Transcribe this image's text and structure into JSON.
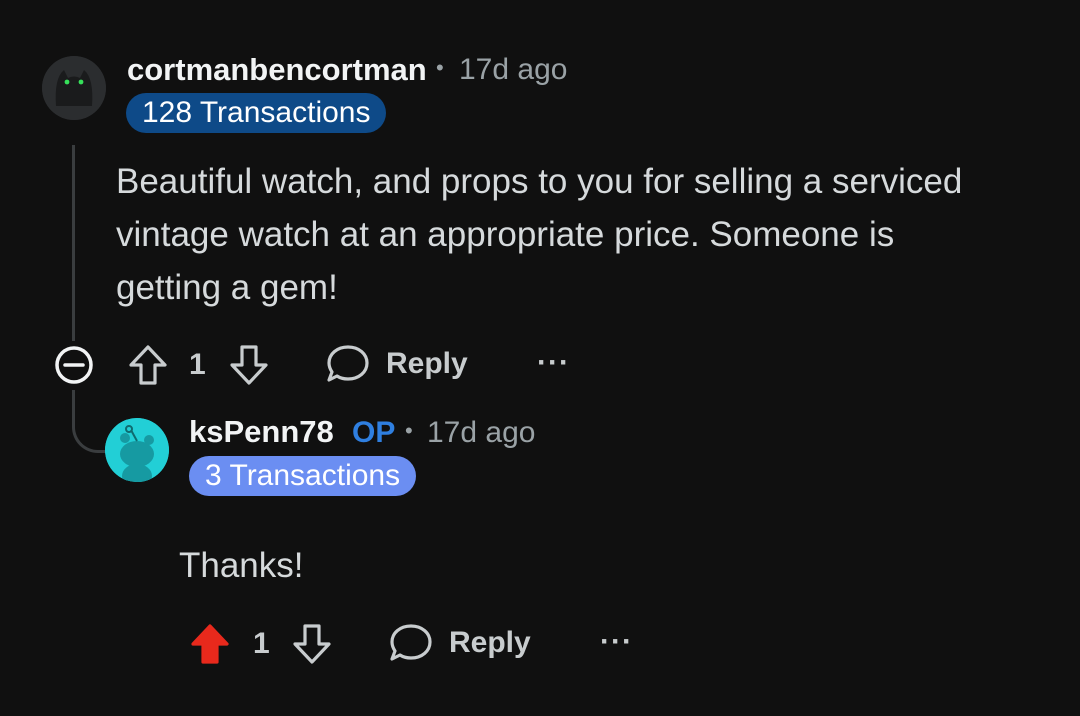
{
  "comments": [
    {
      "username": "cortmanbencortman",
      "time": "17d ago",
      "flair": "128 Transactions",
      "flair_color": "#0e4a88",
      "body": [
        "Beautiful watch, and props to you for selling a serviced",
        "vintage watch at an appropriate price. Someone is",
        "getting a gem!"
      ],
      "votes": "1",
      "reply_label": "Reply",
      "more": "···"
    },
    {
      "username": "ksPenn78",
      "op_tag": "OP",
      "time": "17d ago",
      "flair": "3 Transactions",
      "flair_color": "#6b8ef2",
      "body": "Thanks!",
      "votes": "1",
      "upvoted": true,
      "upvote_color": "#e8291c",
      "reply_label": "Reply",
      "more": "···"
    }
  ],
  "separator": "•"
}
